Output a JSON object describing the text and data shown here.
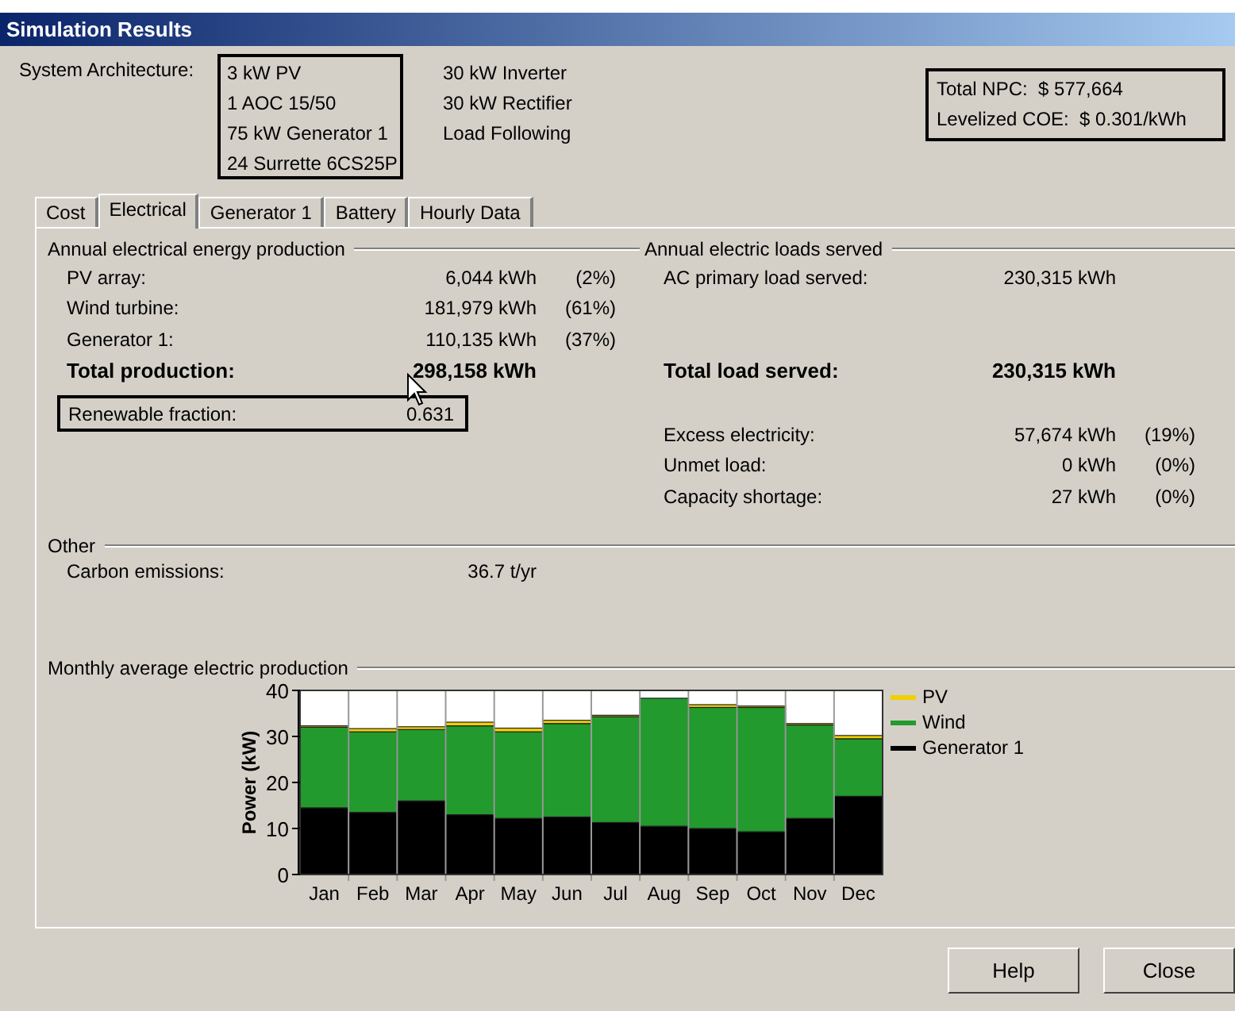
{
  "window": {
    "title": "Simulation Results"
  },
  "architecture": {
    "label": "System Architecture:",
    "highlighted": true,
    "components": [
      "3 kW PV",
      "1 AOC 15/50",
      "75 kW Generator 1",
      "24 Surrette 6CS25P"
    ],
    "controls": [
      "30 kW Inverter",
      "30 kW Rectifier",
      "Load Following"
    ]
  },
  "summary": {
    "highlighted": true,
    "rows": [
      {
        "label": "Total NPC:",
        "value": "$ 577,664"
      },
      {
        "label": "Levelized COE:",
        "value": "$ 0.301/kWh"
      }
    ]
  },
  "tabs": [
    {
      "label": "Cost",
      "selected": false
    },
    {
      "label": "Electrical",
      "selected": true
    },
    {
      "label": "Generator 1",
      "selected": false
    },
    {
      "label": "Battery",
      "selected": false
    },
    {
      "label": "Hourly Data",
      "selected": false
    }
  ],
  "production": {
    "title": "Annual electrical energy production",
    "sources": [
      {
        "label": "PV array:",
        "value": "6,044 kWh",
        "share": "(2%)"
      },
      {
        "label": "Wind turbine:",
        "value": "181,979 kWh",
        "share": "(61%)"
      },
      {
        "label": "Generator 1:",
        "value": "110,135 kWh",
        "share": "(37%)"
      }
    ],
    "total": {
      "label": "Total production:",
      "value": "298,158 kWh"
    },
    "renewable": {
      "label": "Renewable fraction:",
      "value": "0.631",
      "highlighted": true
    }
  },
  "loads": {
    "title": "Annual electric loads served",
    "served": [
      {
        "label": "AC primary load served:",
        "value": "230,315 kWh"
      }
    ],
    "total": {
      "label": "Total load served:",
      "value": "230,315 kWh"
    },
    "balance": [
      {
        "label": "Excess electricity:",
        "value": "57,674 kWh",
        "share": "(19%)"
      },
      {
        "label": "Unmet load:",
        "value": "0 kWh",
        "share": "(0%)"
      },
      {
        "label": "Capacity shortage:",
        "value": "27 kWh",
        "share": "(0%)"
      }
    ]
  },
  "other": {
    "title": "Other",
    "rows": [
      {
        "label": "Carbon emissions:",
        "value": "36.7 t/yr"
      }
    ]
  },
  "monthly": {
    "title": "Monthly average electric production",
    "chart_data": {
      "type": "bar",
      "stacked": true,
      "ylabel": "Power (kW)",
      "ylim": [
        0,
        40
      ],
      "yticks": [
        0,
        10,
        20,
        30,
        40
      ],
      "categories": [
        "Jan",
        "Feb",
        "Mar",
        "Apr",
        "May",
        "Jun",
        "Jul",
        "Aug",
        "Sep",
        "Oct",
        "Nov",
        "Dec"
      ],
      "series": [
        {
          "name": "PV",
          "color": "#f0d000",
          "values": [
            0.3,
            0.7,
            0.6,
            0.8,
            0.8,
            0.7,
            0.3,
            null,
            0.6,
            0.3,
            0.3,
            0.7
          ]
        },
        {
          "name": "Wind",
          "color": "#229a2e",
          "values": [
            17.5,
            17.5,
            15.5,
            19.3,
            18.8,
            20.3,
            23,
            27.8,
            26.3,
            27,
            20.3,
            12.5
          ]
        },
        {
          "name": "Generator 1",
          "color": "#000000",
          "values": [
            14.5,
            13.5,
            16,
            13,
            12.2,
            12.5,
            11.3,
            10.5,
            10,
            9.3,
            12.2,
            17
          ]
        }
      ]
    }
  },
  "buttons": [
    {
      "label": "Help"
    },
    {
      "label": "Close"
    }
  ]
}
